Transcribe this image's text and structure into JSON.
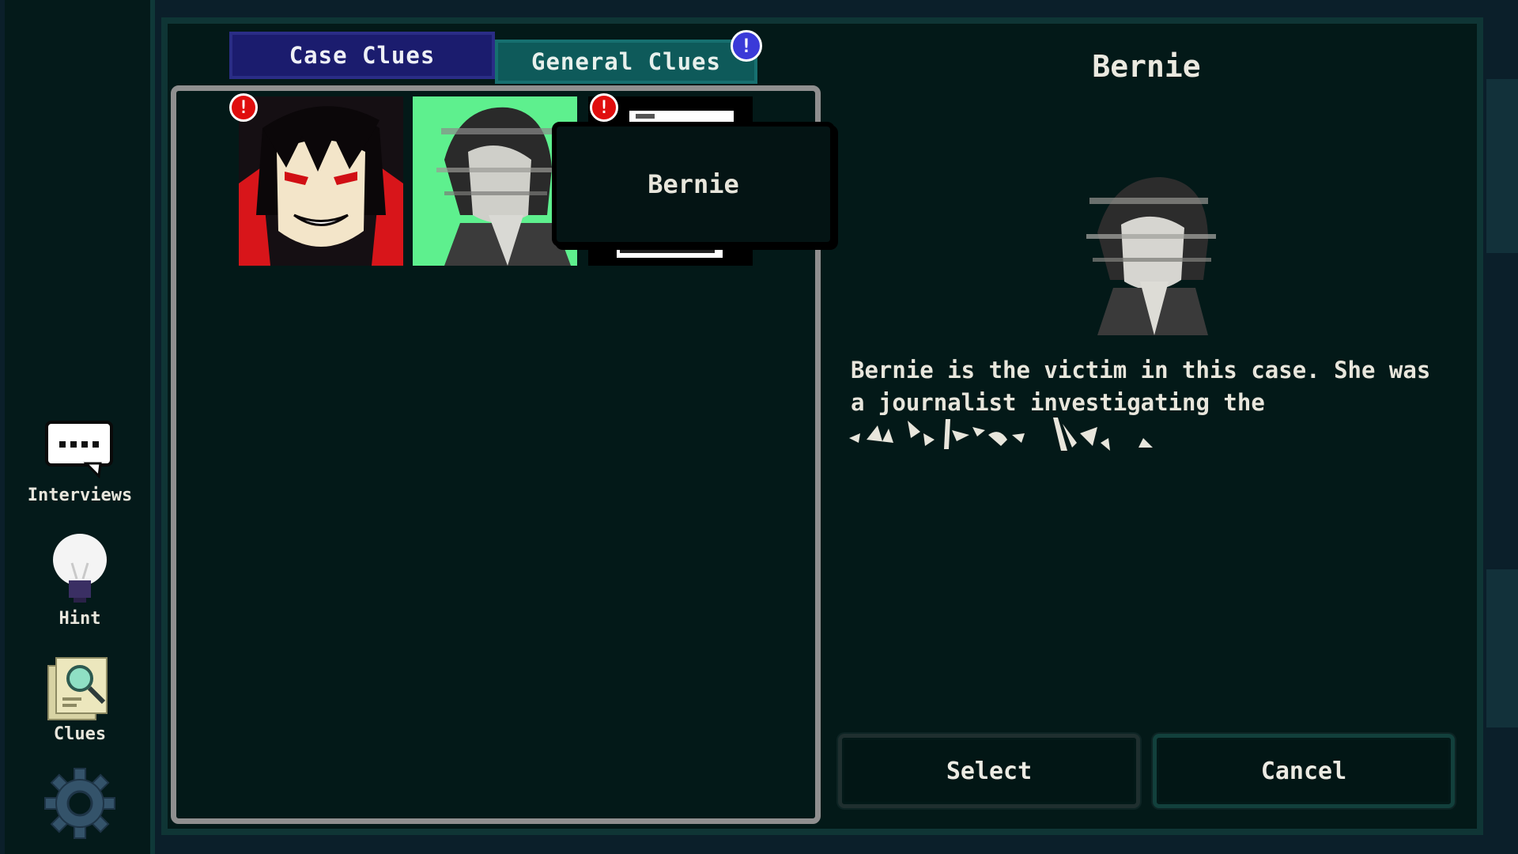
{
  "sidebar": {
    "items": [
      {
        "label": "Interviews",
        "icon": "speech-bubble-icon"
      },
      {
        "label": "Hint",
        "icon": "lightbulb-icon"
      },
      {
        "label": "Clues",
        "icon": "clue-map-icon"
      },
      {
        "label": "",
        "icon": "gear-icon"
      }
    ]
  },
  "tabs": [
    {
      "label": "Case Clues",
      "active": true
    },
    {
      "label": "General Clues",
      "active": false,
      "alert": "!"
    }
  ],
  "clues": [
    {
      "name": "red-eyed-suspect",
      "alert": "!"
    },
    {
      "name": "Bernie",
      "alert": ""
    },
    {
      "name": "document",
      "alert": "!"
    }
  ],
  "tooltip": {
    "text": "Bernie"
  },
  "detail": {
    "name": "Bernie",
    "description": "Bernie is the victim in this case. She was a journalist investigating the"
  },
  "buttons": {
    "select": "Select",
    "cancel": "Cancel"
  },
  "colors": {
    "case_tab": "#1b1c6e",
    "general_tab": "#0e5a5a",
    "alert_red": "#e00e0e",
    "alert_blue": "#3a3ad8",
    "portrait_bg": "#5ef08e",
    "panel_bg": "#031918"
  }
}
